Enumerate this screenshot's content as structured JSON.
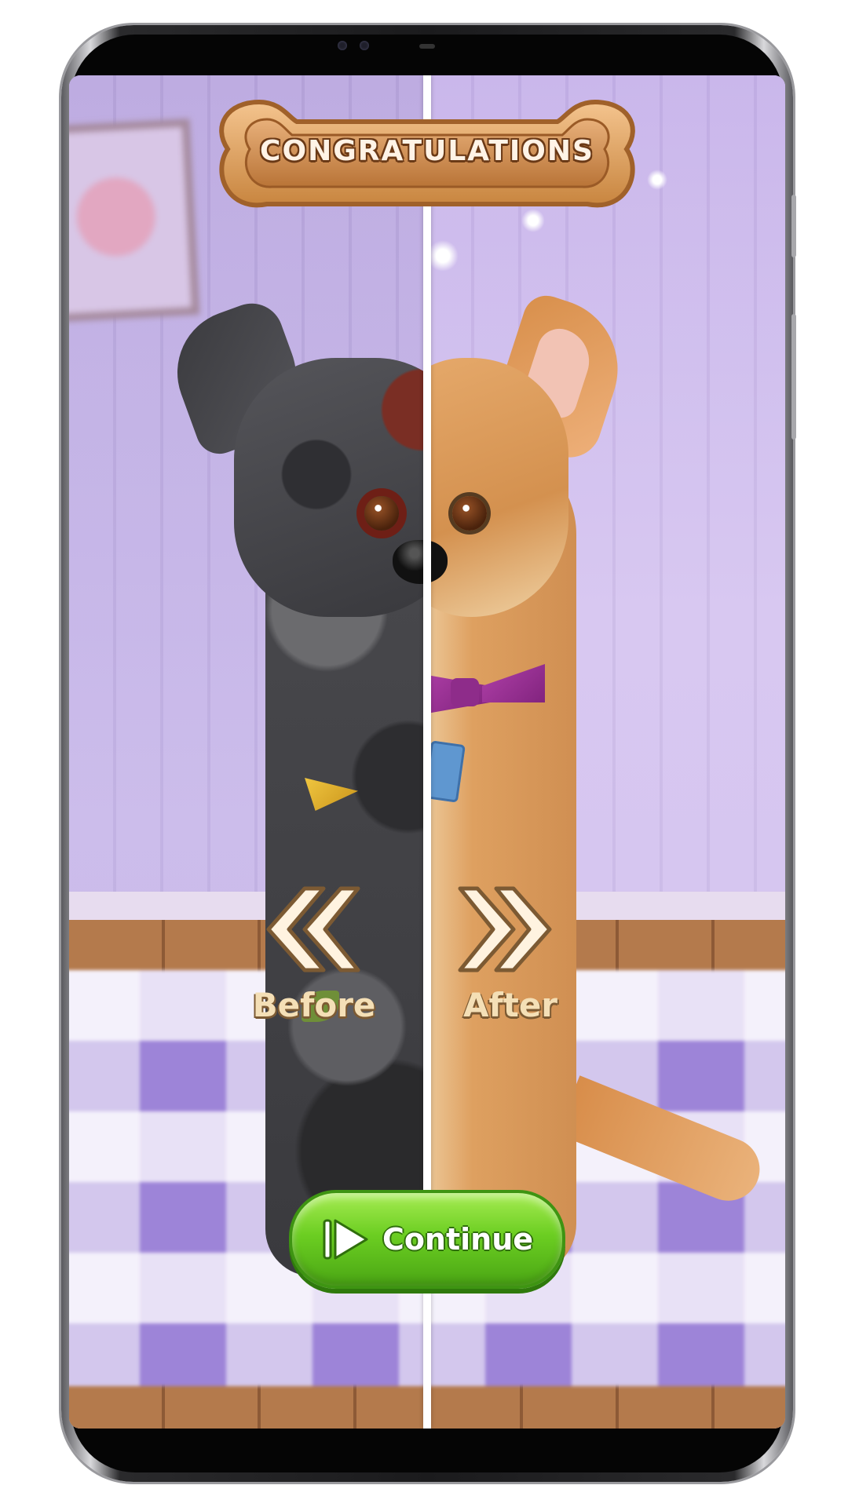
{
  "title": "CONGRATULATIONS",
  "before_label": "Before",
  "after_label": "After",
  "continue_label": "Continue",
  "icons": {
    "left": "double-chevron-left-icon",
    "right": "double-chevron-right-icon",
    "play": "play-icon"
  },
  "colors": {
    "button_green": "#6cce22",
    "label_cream": "#f4dfb6",
    "bone_brown": "#c98b52",
    "wall_purple": "#c8b8ea"
  }
}
